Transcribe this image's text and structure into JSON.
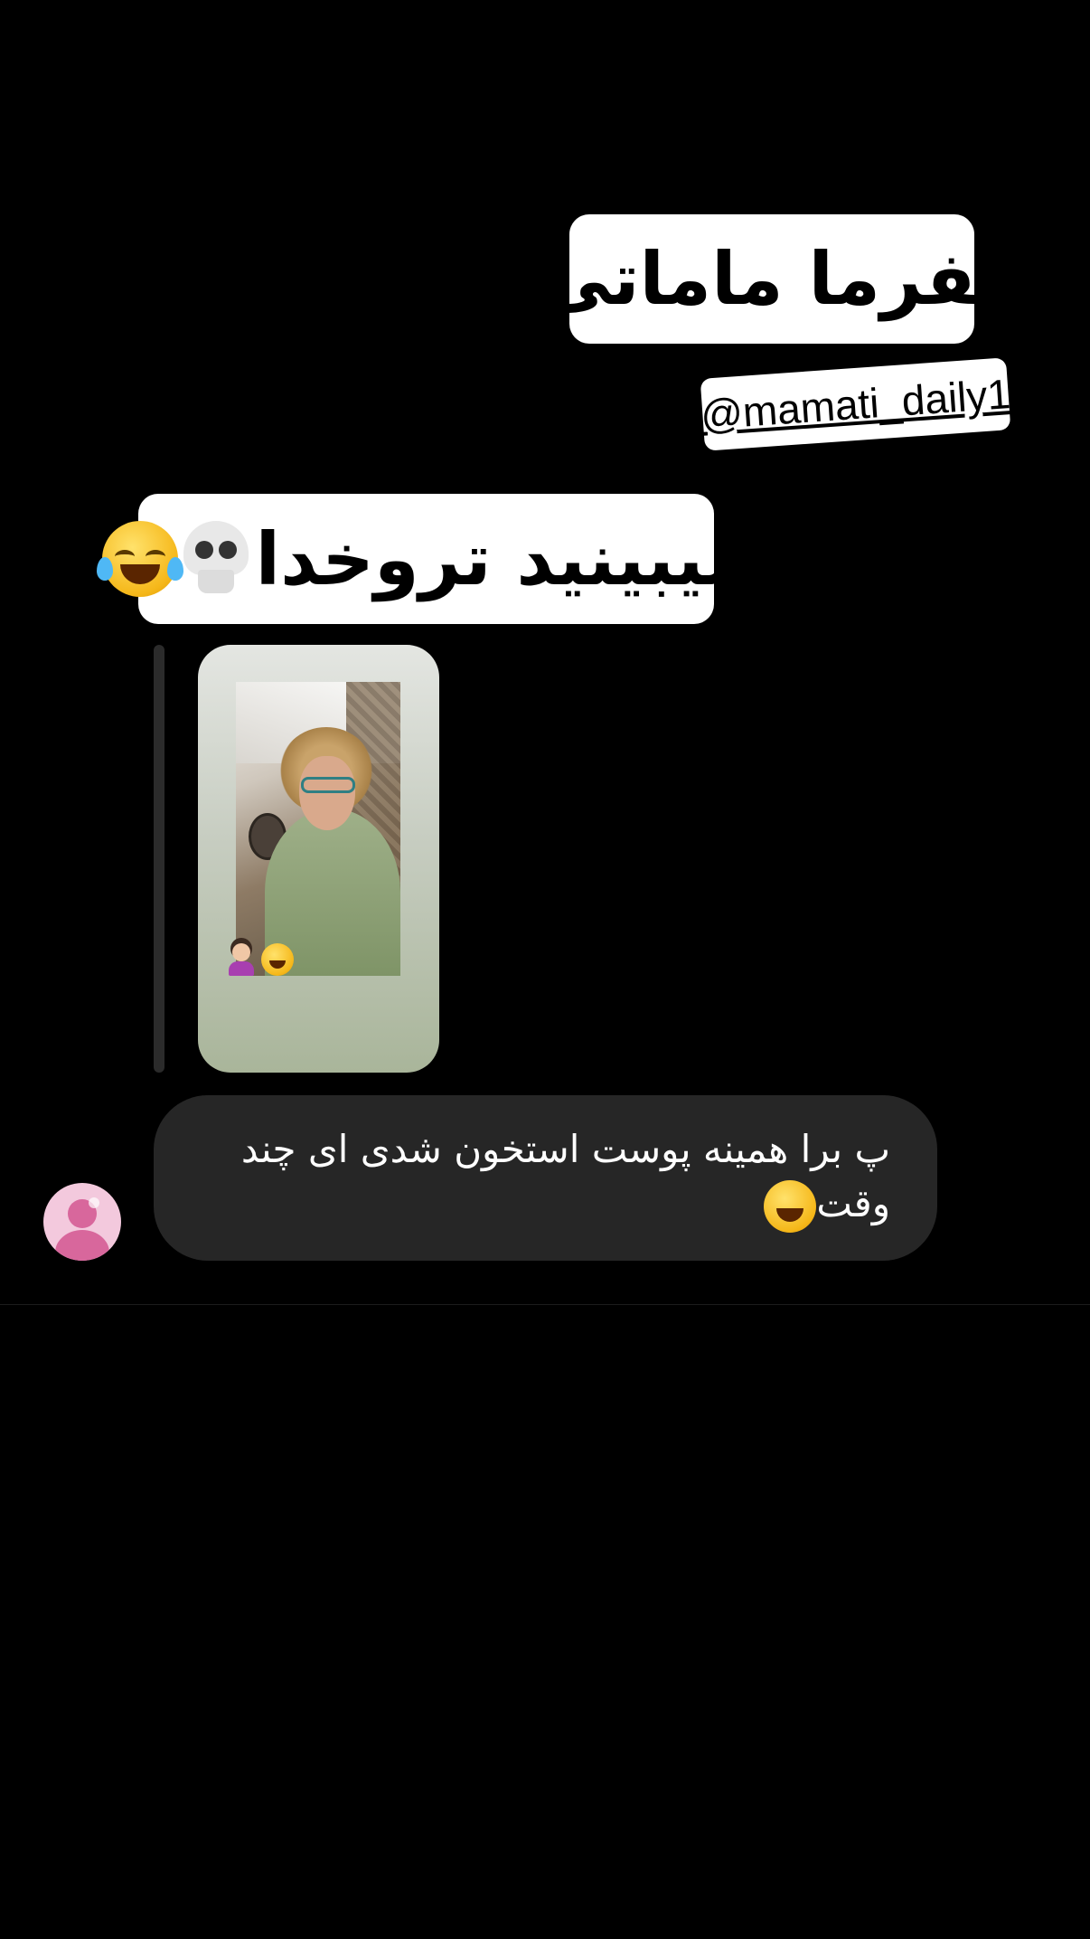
{
  "stickers": {
    "title": "بفرما ماماتی",
    "handle": "@mamati_daily1",
    "caption": "میبینید تروخدا"
  },
  "icons": {
    "caption_emojis": [
      "skull-icon",
      "face-with-tears-of-joy-icon"
    ],
    "story_emojis": [
      "woman-tipping-hand-icon",
      "face-with-tears-of-joy-icon"
    ],
    "message_emoji": "face-with-tears-of-joy-icon",
    "avatar": "default-avatar-icon"
  },
  "message": {
    "line1": "پ برا همینه پوست استخون شدی ای چند",
    "line2": "وقت"
  },
  "colors": {
    "background": "#000000",
    "sticker_bg": "#ffffff",
    "bubble_bg": "#262626",
    "avatar_bg": "#f3c9dd"
  }
}
